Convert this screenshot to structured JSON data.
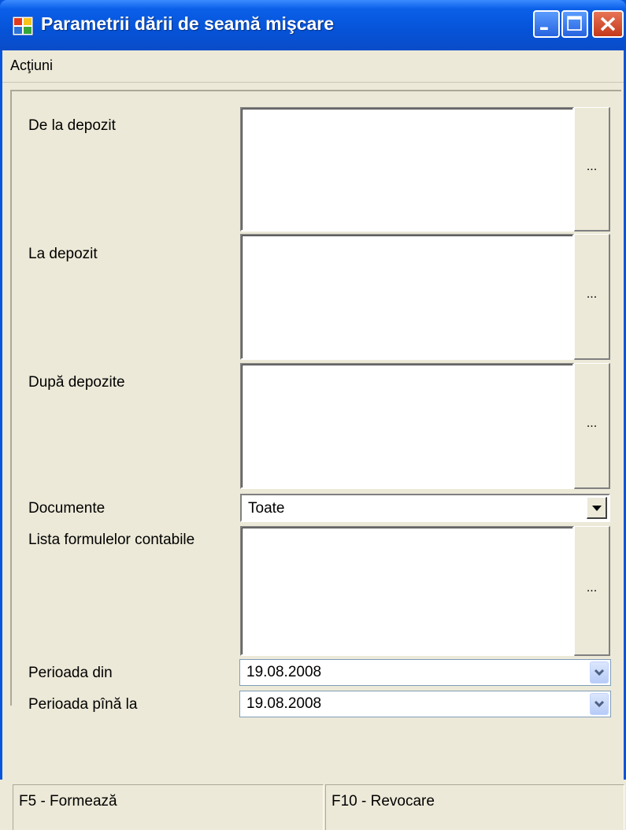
{
  "window": {
    "title": "Parametrii dării de seamă mişcare",
    "colors": {
      "titlebar": "#0653d8",
      "close": "#c4381a",
      "face": "#ece9d8"
    }
  },
  "menu": {
    "actions_label": "Acţiuni"
  },
  "form": {
    "from_warehouse_label": "De la depozit",
    "to_warehouse_label": "La depozit",
    "by_warehouses_label": "După depozite",
    "documents_label": "Documente",
    "documents_value": "Toate",
    "formulas_label": "Lista formulelor contabile",
    "period_from_label": "Perioada din",
    "period_from_value": "19.08.2008",
    "period_to_label": "Perioada pînă la",
    "period_to_value": "19.08.2008",
    "browse_label": "..."
  },
  "status": {
    "f5": "F5 - Formează",
    "f10": "F10 - Revocare"
  }
}
